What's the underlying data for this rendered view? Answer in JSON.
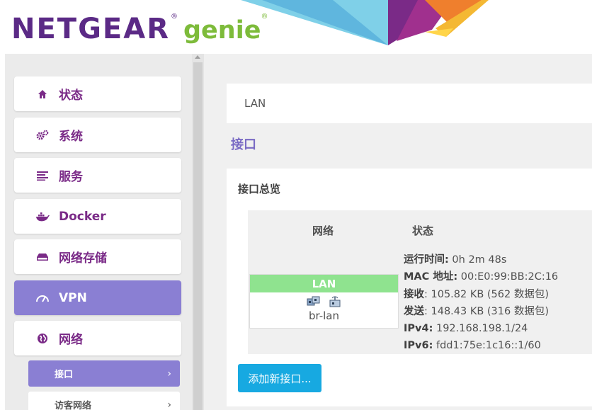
{
  "header": {
    "brand": "NETGEAR",
    "product": "genie",
    "reg_mark": "®"
  },
  "sidebar": {
    "items": [
      {
        "label": "状态",
        "icon": "home-icon"
      },
      {
        "label": "系统",
        "icon": "gears-icon"
      },
      {
        "label": "服务",
        "icon": "list-icon"
      },
      {
        "label": "Docker",
        "icon": "docker-icon"
      },
      {
        "label": "网络存储",
        "icon": "drive-icon"
      },
      {
        "label": "VPN",
        "icon": "gauge-icon",
        "active": true
      },
      {
        "label": "网络",
        "icon": "globe-icon"
      }
    ],
    "subitems": [
      {
        "label": "接口",
        "arrow": "›",
        "active": true
      },
      {
        "label": "访客网络",
        "arrow": "›"
      }
    ]
  },
  "main": {
    "tab_lan": "LAN",
    "section_title": "接口",
    "panel_title": "接口总览",
    "table": {
      "col_network": "网络",
      "col_status": "状态"
    },
    "interface": {
      "name": "LAN",
      "device": "br-lan"
    },
    "status": [
      {
        "key": "运行时间:",
        "value": " 0h 2m 48s"
      },
      {
        "key": "MAC 地址:",
        "value": " 00:E0:99:BB:2C:16"
      },
      {
        "key": "接收",
        "value": ": 105.82 KB (562 数据包)"
      },
      {
        "key": "发送",
        "value": ": 148.43 KB (316 数据包)"
      },
      {
        "key": "IPv4:",
        "value": " 192.168.198.1/24"
      },
      {
        "key": "IPv6:",
        "value": " fdd1:75e:1c16::1/60"
      }
    ],
    "add_button": "添加新接口..."
  },
  "colors": {
    "brand_purple": "#5b2a86",
    "brand_green": "#7dbb3a",
    "menu_text": "#7a2a87",
    "active_bg": "#8a7fd3",
    "lan_green": "#8fe38f",
    "button_blue": "#17a9e1"
  }
}
